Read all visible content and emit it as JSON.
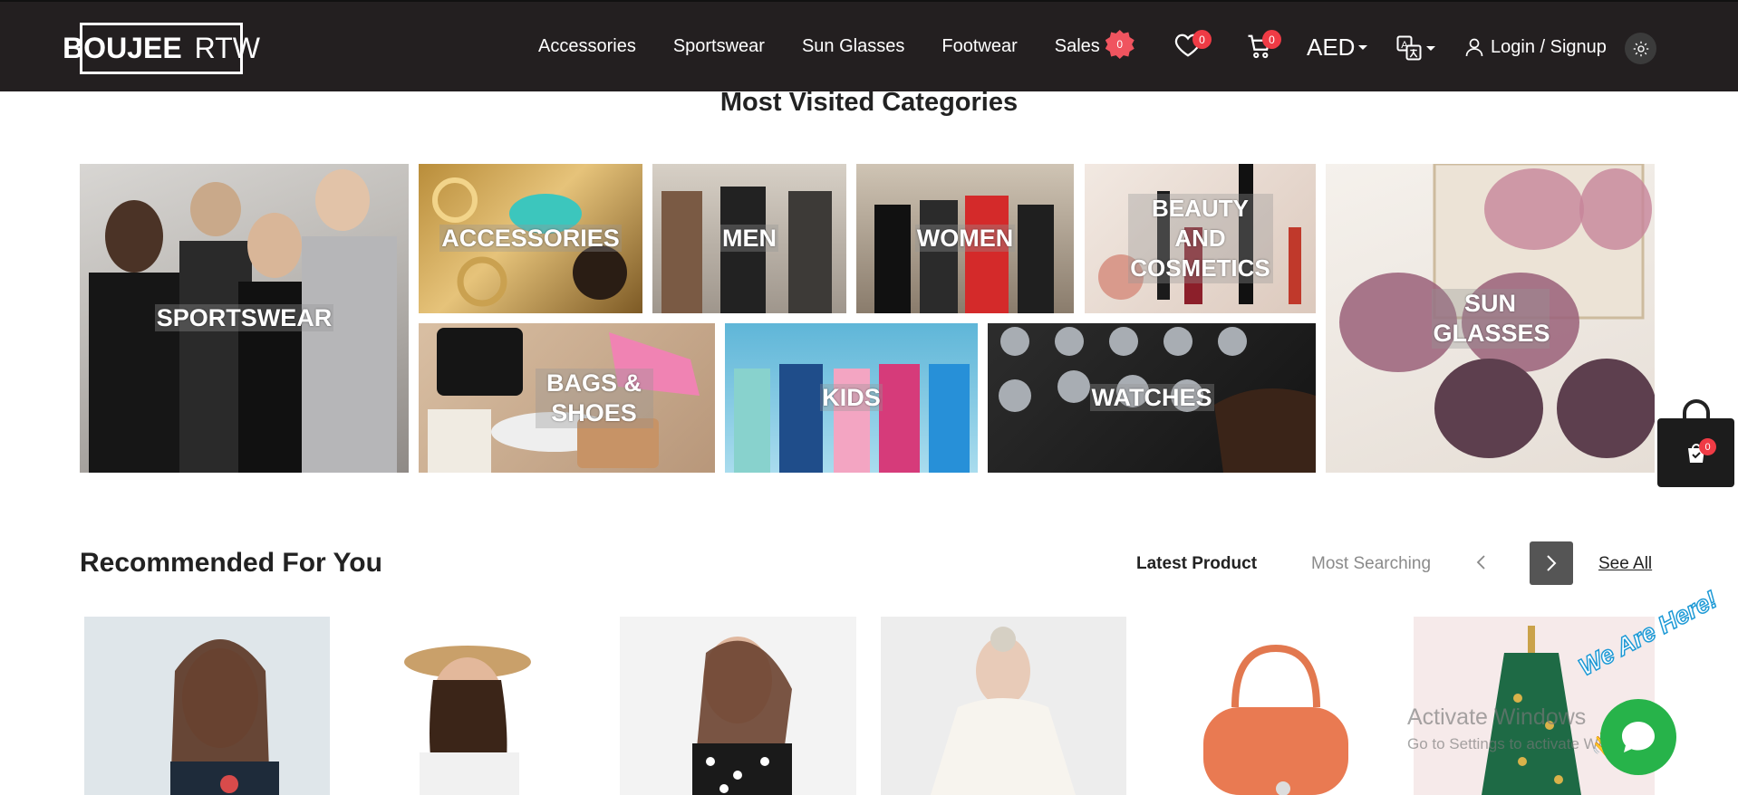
{
  "header": {
    "logo_left": "BOUJEE",
    "logo_right": "RTW",
    "nav": [
      "Accessories",
      "Sportswear",
      "Sun Glasses",
      "Footwear",
      "Sales"
    ],
    "sales_badge": "0",
    "wishlist_count": "0",
    "cart_count": "0",
    "currency": "AED",
    "login_label": "Login / Signup"
  },
  "categories": {
    "title": "Most Visited Categories",
    "tiles": [
      {
        "label": "SPORTSWEAR"
      },
      {
        "label": "ACCESSORIES"
      },
      {
        "label": "MEN"
      },
      {
        "label": "WOMEN"
      },
      {
        "label": "BEAUTY AND COSMETICS"
      },
      {
        "label": "SUN GLASSES"
      },
      {
        "label": "BAGS & SHOES"
      },
      {
        "label": "KIDS"
      },
      {
        "label": "WATCHES"
      }
    ]
  },
  "recommended": {
    "title": "Recommended For You",
    "tab_latest": "Latest Product",
    "tab_most_searching": "Most Searching",
    "see_all": "See All"
  },
  "floating": {
    "cart_count": "0",
    "chat_banner": "We Are Here!"
  },
  "os_overlay": {
    "activate_title": "Activate Windows",
    "activate_sub": "Go to Settings to activate Windows."
  }
}
